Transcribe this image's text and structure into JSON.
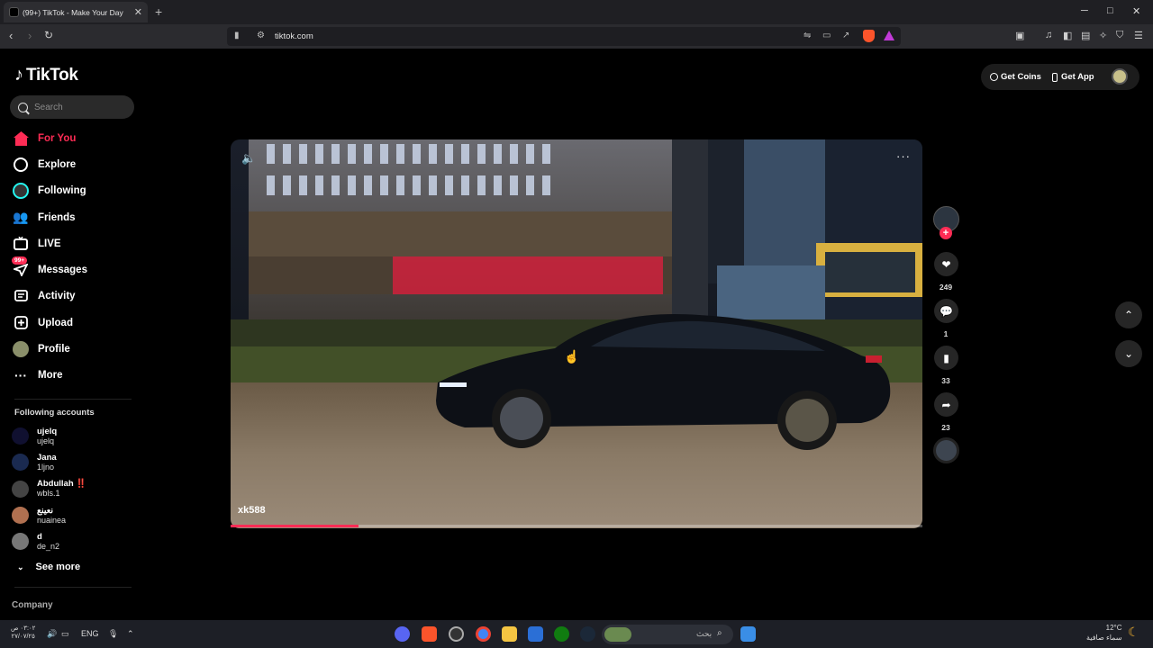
{
  "browser": {
    "tab_title": "(99+) TikTok - Make Your Day",
    "url": "tiktok.com",
    "new_tab": "+",
    "window_controls": [
      "─",
      "□",
      "✕"
    ]
  },
  "brand": {
    "logo_text": "TikTok"
  },
  "search": {
    "placeholder": "Search"
  },
  "nav": {
    "items": [
      {
        "label": "For You",
        "icon": "home-icon"
      },
      {
        "label": "Explore",
        "icon": "compass-icon"
      },
      {
        "label": "Following",
        "icon": "following-icon"
      },
      {
        "label": "Friends",
        "icon": "friends-icon"
      },
      {
        "label": "LIVE",
        "icon": "live-icon"
      },
      {
        "label": "Messages",
        "icon": "messages-icon",
        "badge": "99+"
      },
      {
        "label": "Activity",
        "icon": "activity-icon"
      },
      {
        "label": "Upload",
        "icon": "upload-icon"
      },
      {
        "label": "Profile",
        "icon": "profile-icon"
      },
      {
        "label": "More",
        "icon": "more-icon"
      }
    ]
  },
  "following_accounts": {
    "title": "Following accounts",
    "items": [
      {
        "name": "ujelq",
        "username": "ujelq",
        "avatar_color": "#101030"
      },
      {
        "name": "Jana",
        "username": "1ljno",
        "avatar_color": "#1a2a50"
      },
      {
        "name": "Abdullah ‼️",
        "username": "wbls.1",
        "avatar_color": "#444444"
      },
      {
        "name": "نعينع",
        "username": "nuainea",
        "avatar_color": "#b07050"
      },
      {
        "name": "d",
        "username": "de_n2",
        "avatar_color": "#777777"
      }
    ],
    "see_more": "See more"
  },
  "footer": {
    "company": "Company"
  },
  "header": {
    "get_coins": "Get Coins",
    "get_app": "Get App"
  },
  "video": {
    "author": "xk588",
    "progress": 0.185
  },
  "actions": {
    "likes": "249",
    "comments": "1",
    "saves": "33",
    "shares": "23"
  },
  "taskbar": {
    "time": "٠٣:٠٢ ص",
    "date": "٢٧/٠٧/٢٥",
    "lang": "ENG",
    "search_text": "بحث",
    "temperature": "12°C",
    "weather_text": "سماء صافية"
  },
  "colors": {
    "accent": "#fe2c55",
    "background": "#000000"
  }
}
